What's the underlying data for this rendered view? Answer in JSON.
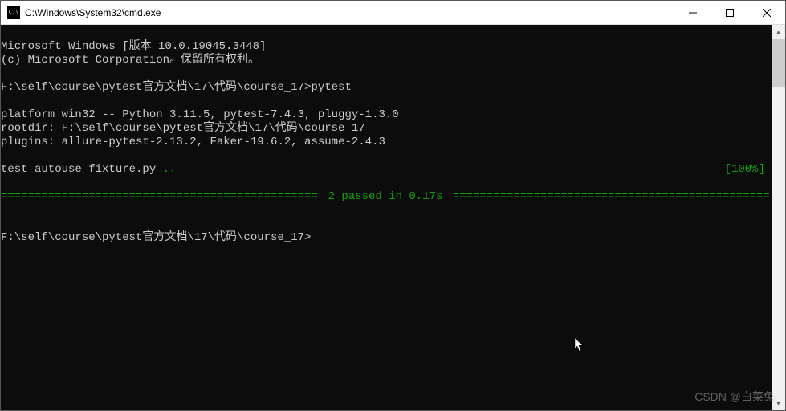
{
  "window": {
    "title": "C:\\Windows\\System32\\cmd.exe"
  },
  "terminal": {
    "header1": "Microsoft Windows [版本 10.0.19045.3448]",
    "header2": "(c) Microsoft Corporation。保留所有权利。",
    "prompt1_path": "F:\\self\\course\\pytest官方文档\\17\\代码\\course_17>",
    "prompt1_cmd": "pytest",
    "platform": "platform win32 -- Python 3.11.5, pytest-7.4.3, pluggy-1.3.0",
    "rootdir": "rootdir: F:\\self\\course\\pytest官方文档\\17\\代码\\course_17",
    "plugins": "plugins: allure-pytest-2.13.2, Faker-19.6.2, assume-2.4.3",
    "testfile": "test_autouse_fixture.py ",
    "testdots": "..",
    "progress": "[100%]",
    "summary": " 2 passed in 0.17s ",
    "prompt2": "F:\\self\\course\\pytest官方文档\\17\\代码\\course_17>",
    "eqfill": "=========================================================="
  },
  "watermark": "CSDN @白菜兔"
}
